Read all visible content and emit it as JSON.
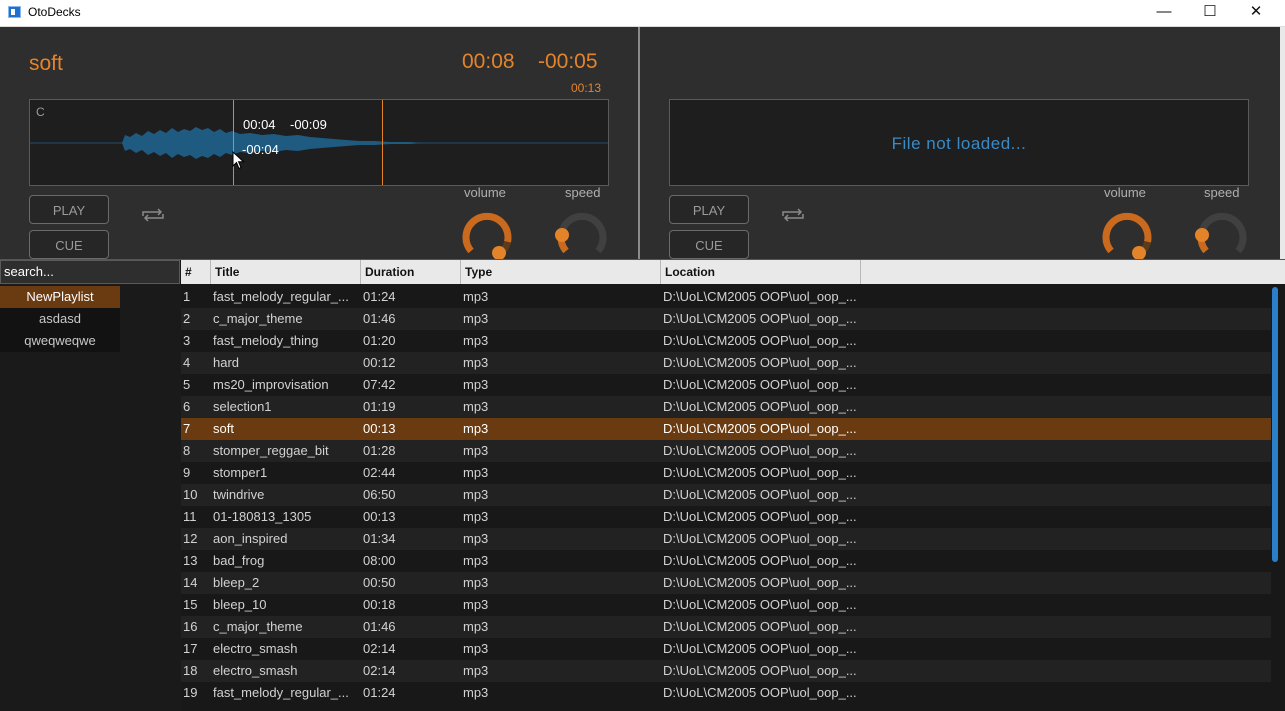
{
  "window": {
    "title": "OtoDecks",
    "minimize": "—",
    "maximize": "☐",
    "close": "✕"
  },
  "colors": {
    "accent": "#e4842a",
    "selection": "#6a3a10",
    "link_blue": "#3a8ac6"
  },
  "deck1": {
    "track": "soft",
    "time_position": "00:08",
    "time_remaining": "-00:05",
    "time_total": "00:13",
    "waveform_key": "C",
    "hover_position": "00:04",
    "hover_remaining": "-00:09",
    "hover_remaining2": "-00:04",
    "play": "PLAY",
    "cue": "CUE",
    "volume_label": "volume",
    "speed_label": "speed",
    "volume_level": 0.85,
    "speed_level": 0.15
  },
  "deck2": {
    "file_message": "File not loaded...",
    "play": "PLAY",
    "cue": "CUE",
    "volume_label": "volume",
    "speed_label": "speed",
    "volume_level": 0.85,
    "speed_level": 0.15
  },
  "search": {
    "placeholder": "search..."
  },
  "playlists": [
    "NewPlaylist",
    "asdasd",
    "qweqweqwe"
  ],
  "columns": [
    "#",
    "Title",
    "Duration",
    "Type",
    "Location"
  ],
  "tracks": [
    {
      "n": "1",
      "title": "fast_melody_regular_...",
      "duration": "01:24",
      "type": "mp3",
      "location": "D:\\UoL\\CM2005 OOP\\uol_oop_..."
    },
    {
      "n": "2",
      "title": "c_major_theme",
      "duration": "01:46",
      "type": "mp3",
      "location": "D:\\UoL\\CM2005 OOP\\uol_oop_..."
    },
    {
      "n": "3",
      "title": "fast_melody_thing",
      "duration": "01:20",
      "type": "mp3",
      "location": "D:\\UoL\\CM2005 OOP\\uol_oop_..."
    },
    {
      "n": "4",
      "title": "hard",
      "duration": "00:12",
      "type": "mp3",
      "location": "D:\\UoL\\CM2005 OOP\\uol_oop_..."
    },
    {
      "n": "5",
      "title": "ms20_improvisation",
      "duration": "07:42",
      "type": "mp3",
      "location": "D:\\UoL\\CM2005 OOP\\uol_oop_..."
    },
    {
      "n": "6",
      "title": "selection1",
      "duration": "01:19",
      "type": "mp3",
      "location": "D:\\UoL\\CM2005 OOP\\uol_oop_..."
    },
    {
      "n": "7",
      "title": "soft",
      "duration": "00:13",
      "type": "mp3",
      "location": "D:\\UoL\\CM2005 OOP\\uol_oop_..."
    },
    {
      "n": "8",
      "title": "stomper_reggae_bit",
      "duration": "01:28",
      "type": "mp3",
      "location": "D:\\UoL\\CM2005 OOP\\uol_oop_..."
    },
    {
      "n": "9",
      "title": "stomper1",
      "duration": "02:44",
      "type": "mp3",
      "location": "D:\\UoL\\CM2005 OOP\\uol_oop_..."
    },
    {
      "n": "10",
      "title": "twindrive",
      "duration": "06:50",
      "type": "mp3",
      "location": "D:\\UoL\\CM2005 OOP\\uol_oop_..."
    },
    {
      "n": "11",
      "title": "01-180813_1305",
      "duration": "00:13",
      "type": "mp3",
      "location": "D:\\UoL\\CM2005 OOP\\uol_oop_..."
    },
    {
      "n": "12",
      "title": "aon_inspired",
      "duration": "01:34",
      "type": "mp3",
      "location": "D:\\UoL\\CM2005 OOP\\uol_oop_..."
    },
    {
      "n": "13",
      "title": "bad_frog",
      "duration": "08:00",
      "type": "mp3",
      "location": "D:\\UoL\\CM2005 OOP\\uol_oop_..."
    },
    {
      "n": "14",
      "title": "bleep_2",
      "duration": "00:50",
      "type": "mp3",
      "location": "D:\\UoL\\CM2005 OOP\\uol_oop_..."
    },
    {
      "n": "15",
      "title": "bleep_10",
      "duration": "00:18",
      "type": "mp3",
      "location": "D:\\UoL\\CM2005 OOP\\uol_oop_..."
    },
    {
      "n": "16",
      "title": "c_major_theme",
      "duration": "01:46",
      "type": "mp3",
      "location": "D:\\UoL\\CM2005 OOP\\uol_oop_..."
    },
    {
      "n": "17",
      "title": "electro_smash",
      "duration": "02:14",
      "type": "mp3",
      "location": "D:\\UoL\\CM2005 OOP\\uol_oop_..."
    },
    {
      "n": "18",
      "title": "electro_smash",
      "duration": "02:14",
      "type": "mp3",
      "location": "D:\\UoL\\CM2005 OOP\\uol_oop_..."
    },
    {
      "n": "19",
      "title": "fast_melody_regular_...",
      "duration": "01:24",
      "type": "mp3",
      "location": "D:\\UoL\\CM2005 OOP\\uol_oop_..."
    }
  ],
  "selected_track": "7"
}
